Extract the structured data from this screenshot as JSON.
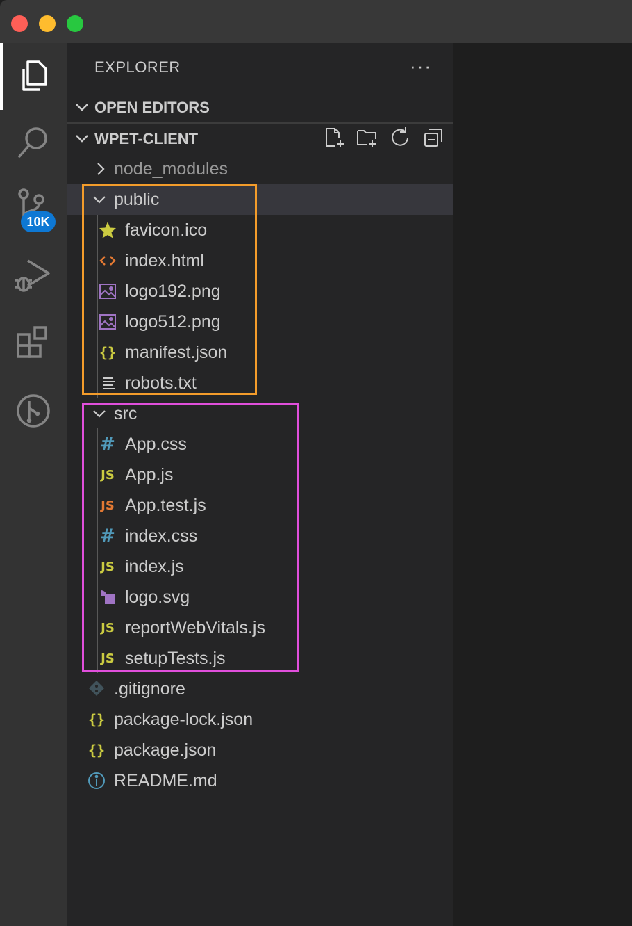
{
  "window": {
    "controls": [
      "close",
      "minimize",
      "zoom"
    ]
  },
  "activity_bar": {
    "items": [
      {
        "icon": "files-icon",
        "active": true
      },
      {
        "icon": "search-icon",
        "active": false
      },
      {
        "icon": "source-control-icon",
        "active": false,
        "badge": "10K"
      },
      {
        "icon": "run-debug-icon",
        "active": false
      },
      {
        "icon": "extensions-icon",
        "active": false
      },
      {
        "icon": "git-graph-icon",
        "active": false
      }
    ]
  },
  "sidebar": {
    "title": "EXPLORER",
    "more_label": "···",
    "open_editors": {
      "label": "OPEN EDITORS",
      "expanded": false
    },
    "project": {
      "label": "WPET-CLIENT",
      "expanded": true,
      "toolbar": [
        "new-file-icon",
        "new-folder-icon",
        "refresh-icon",
        "collapse-all-icon"
      ]
    },
    "tree": [
      {
        "name": "node_modules",
        "type": "folder",
        "expanded": false,
        "dim": true
      },
      {
        "name": "public",
        "type": "folder",
        "expanded": true,
        "selected": true,
        "children": [
          {
            "name": "favicon.ico",
            "icon": "star-icon"
          },
          {
            "name": "index.html",
            "icon": "html-icon"
          },
          {
            "name": "logo192.png",
            "icon": "image-icon"
          },
          {
            "name": "logo512.png",
            "icon": "image-icon"
          },
          {
            "name": "manifest.json",
            "icon": "json-icon"
          },
          {
            "name": "robots.txt",
            "icon": "text-file-icon"
          }
        ]
      },
      {
        "name": "src",
        "type": "folder",
        "expanded": true,
        "children": [
          {
            "name": "App.css",
            "icon": "css-icon"
          },
          {
            "name": "App.js",
            "icon": "js-icon"
          },
          {
            "name": "App.test.js",
            "icon": "js-test-icon"
          },
          {
            "name": "index.css",
            "icon": "css-icon"
          },
          {
            "name": "index.js",
            "icon": "js-icon"
          },
          {
            "name": "logo.svg",
            "icon": "svg-icon"
          },
          {
            "name": "reportWebVitals.js",
            "icon": "js-icon"
          },
          {
            "name": "setupTests.js",
            "icon": "js-icon"
          }
        ]
      },
      {
        "name": ".gitignore",
        "icon": "git-icon"
      },
      {
        "name": "package-lock.json",
        "icon": "json-icon"
      },
      {
        "name": "package.json",
        "icon": "json-icon"
      },
      {
        "name": "README.md",
        "icon": "info-icon"
      }
    ]
  },
  "highlights": [
    {
      "target": "public",
      "color": "#f39c2b"
    },
    {
      "target": "src",
      "color": "#e14fdc"
    }
  ],
  "colors": {
    "js": "#cbcb41",
    "js_test": "#e37933",
    "css": "#519aba",
    "html": "#e37933",
    "image": "#a074c4",
    "badge": "#0e78d4"
  },
  "js_glyph": "JS",
  "css_glyph": "#",
  "json_glyph": "{}"
}
